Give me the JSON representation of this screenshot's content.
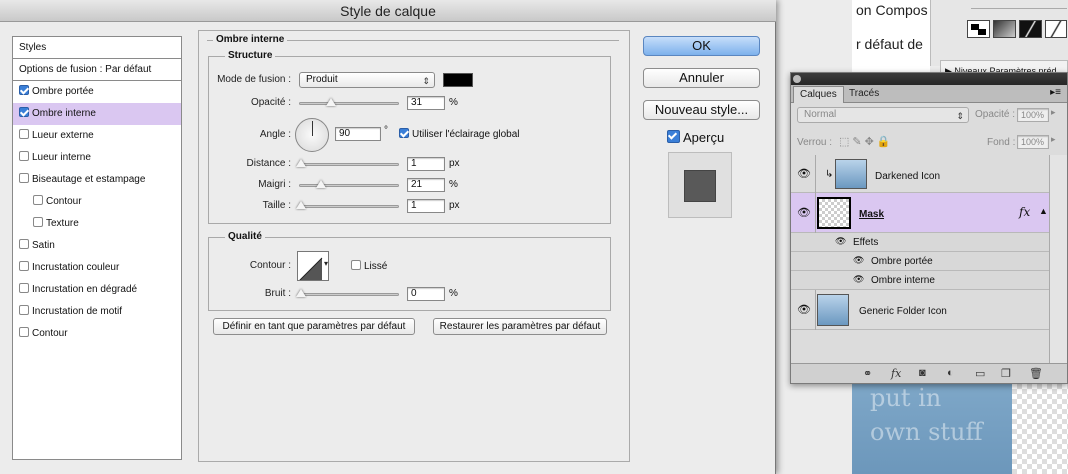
{
  "background": {
    "doc_text_1": "on Compos",
    "doc_text_2": "r défaut de",
    "adjustments_text": "▶ Niveaux Paramètres préd",
    "image_text_1": "put in",
    "image_text_2": "own stuff"
  },
  "dialog": {
    "title": "Style de calque",
    "styles_list": [
      {
        "label": "Styles",
        "checkbox": false,
        "checked": false,
        "selected": false
      },
      {
        "label": "Options de fusion : Par défaut",
        "checkbox": false,
        "checked": false,
        "selected": false
      },
      {
        "label": "Ombre portée",
        "checkbox": true,
        "checked": true,
        "selected": false
      },
      {
        "label": "Ombre interne",
        "checkbox": true,
        "checked": true,
        "selected": true
      },
      {
        "label": "Lueur externe",
        "checkbox": true,
        "checked": false,
        "selected": false
      },
      {
        "label": "Lueur interne",
        "checkbox": true,
        "checked": false,
        "selected": false
      },
      {
        "label": "Biseautage et estampage",
        "checkbox": true,
        "checked": false,
        "selected": false
      },
      {
        "label": "Contour",
        "checkbox": true,
        "checked": false,
        "selected": false
      },
      {
        "label": "Texture",
        "checkbox": true,
        "checked": false,
        "selected": false
      },
      {
        "label": "Satin",
        "checkbox": true,
        "checked": false,
        "selected": false
      },
      {
        "label": "Incrustation couleur",
        "checkbox": true,
        "checked": false,
        "selected": false
      },
      {
        "label": "Incrustation en dégradé",
        "checkbox": true,
        "checked": false,
        "selected": false
      },
      {
        "label": "Incrustation de motif",
        "checkbox": true,
        "checked": false,
        "selected": false
      },
      {
        "label": "Contour",
        "checkbox": true,
        "checked": false,
        "selected": false
      }
    ],
    "section_title": "Ombre interne",
    "structure": {
      "title": "Structure",
      "blend_mode_label": "Mode de fusion :",
      "blend_mode_value": "Produit",
      "color": "#000000",
      "opacity_label": "Opacité :",
      "opacity_value": "31",
      "opacity_fraction": 0.31,
      "unit_percent": "%",
      "angle_label": "Angle :",
      "angle_value": "90",
      "degree_symbol": "°",
      "global_light_label": "Utiliser l'éclairage global",
      "distance_label": "Distance :",
      "distance_value": "1",
      "unit_px": "px",
      "choke_label": "Maigri :",
      "choke_value": "21",
      "size_label": "Taille :",
      "size_value": "1"
    },
    "quality": {
      "title": "Qualité",
      "contour_label": "Contour :",
      "antialias_label": "Lissé",
      "noise_label": "Bruit :",
      "noise_value": "0"
    },
    "make_default_label": "Définir en tant que paramètres par défaut",
    "reset_default_label": "Restaurer les paramètres par défaut",
    "ok_label": "OK",
    "cancel_label": "Annuler",
    "new_style_label": "Nouveau style...",
    "preview_label": "Aperçu"
  },
  "layers_panel": {
    "tab_layers": "Calques",
    "tab_paths": "Tracés",
    "blend_mode": "Normal",
    "opacity_label": "Opacité :",
    "opacity_value": "100%",
    "lock_label": "Verrou :",
    "fill_label": "Fond :",
    "fill_value": "100%",
    "layers": {
      "darkened": "Darkened Icon",
      "mask": "Mask",
      "fx": "fx",
      "effects": "Effets",
      "effect_drop_shadow": "Ombre portée",
      "effect_inner_shadow": "Ombre interne",
      "generic_folder": "Generic Folder Icon"
    }
  },
  "colors": {
    "selection": "#dac7f1",
    "ok_button": "#7db1ec"
  }
}
